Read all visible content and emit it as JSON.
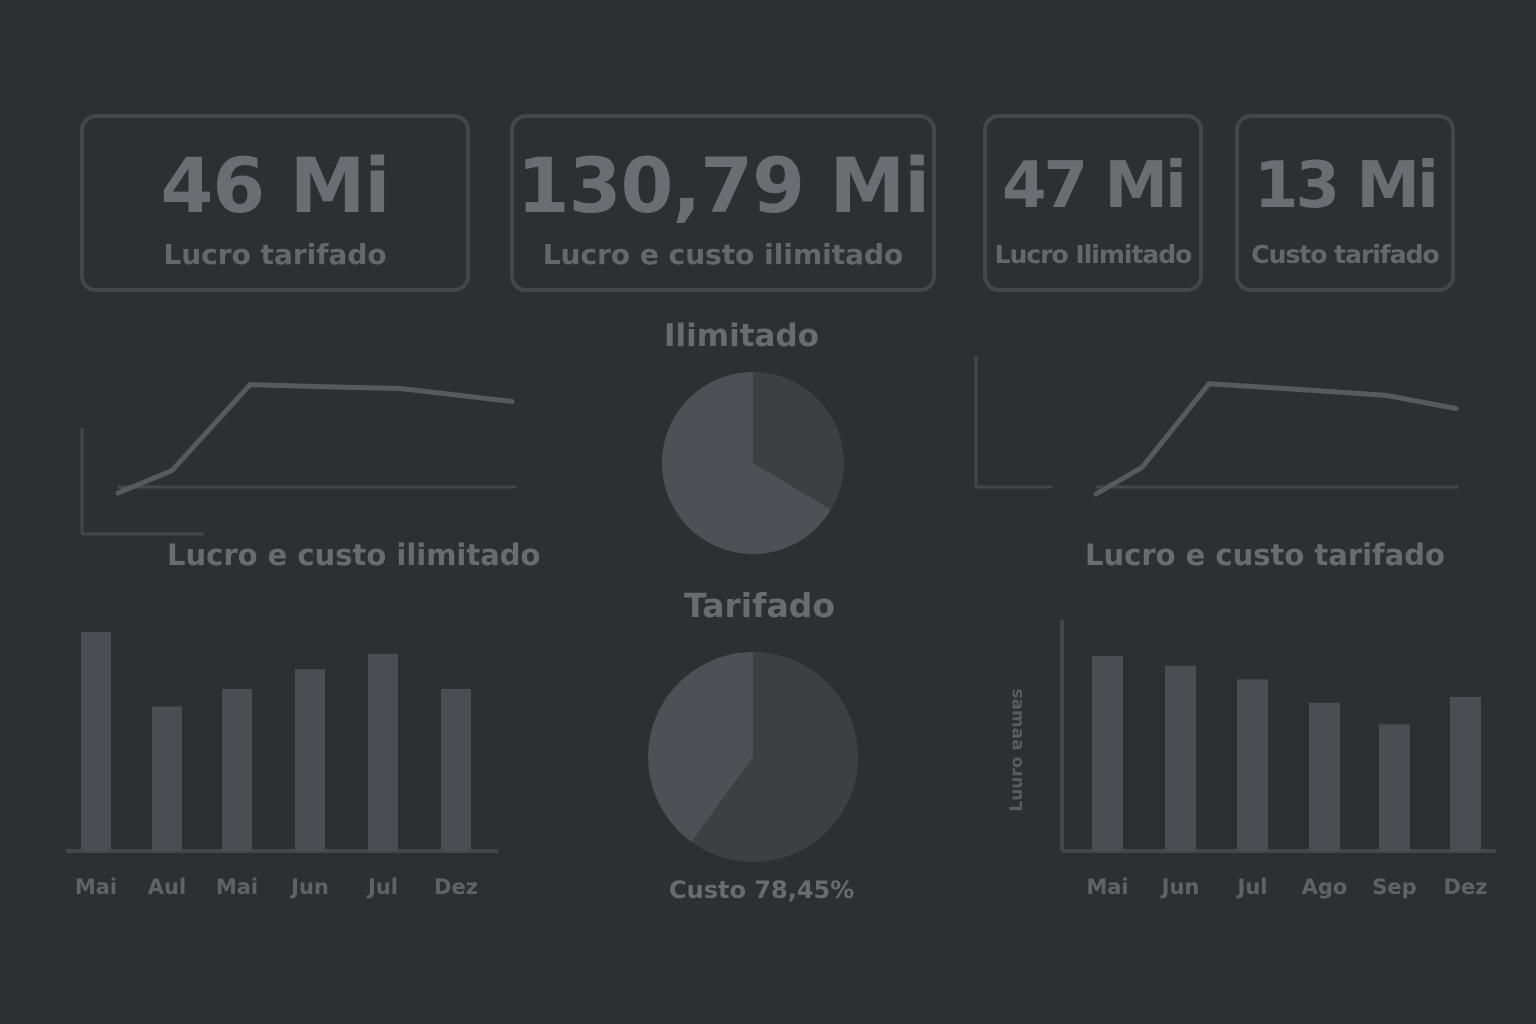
{
  "kpis": [
    {
      "value": "46 Mi",
      "label": "Lucro tarifado"
    },
    {
      "value": "130,79 Mi",
      "label": "Lucro e custo ilimitado"
    },
    {
      "value": "47 Mi",
      "label": "Lucro Ilimitado"
    },
    {
      "value": "13 Mi",
      "label": "Custo tarifado"
    }
  ],
  "titles": {
    "pie_top": "Ilimitado",
    "pie_bottom": "Tarifado",
    "line_left": "Lucro e custo ilimitado",
    "line_right": "Lucro e custo tarifado",
    "pie_bottom_caption": "Custo 78,45%"
  },
  "colors": {
    "background": "#2e2f33",
    "line": "#58595e",
    "bar": "#4c4d52",
    "pie_light": "#4f5055",
    "pie_dark": "#3e3f43",
    "axis": "#45464b",
    "text": "#6a6b70"
  },
  "chart_data": [
    {
      "type": "line",
      "id": "line_left",
      "title": "",
      "series": [
        {
          "values": [
            0,
            12,
            58,
            57,
            56,
            49
          ]
        }
      ],
      "ylim": [
        0,
        60
      ]
    },
    {
      "type": "line",
      "id": "line_right",
      "title": "",
      "series": [
        {
          "values": [
            0,
            14,
            58,
            55,
            52,
            45
          ]
        }
      ],
      "ylim": [
        0,
        60
      ]
    },
    {
      "type": "pie",
      "id": "pie_top",
      "title": "Ilimitado",
      "slices": [
        {
          "value": 0.336,
          "color": "#3e3f43"
        },
        {
          "value": 0.664,
          "color": "#4f5055"
        }
      ]
    },
    {
      "type": "pie",
      "id": "pie_bottom",
      "title": "Tarifado",
      "slices": [
        {
          "value": 0.6,
          "color": "#3e3f43"
        },
        {
          "value": 0.4,
          "color": "#4f5055"
        }
      ],
      "caption": "Custo 78,45%"
    },
    {
      "type": "bar",
      "id": "bar_left",
      "categories": [
        "Mai",
        "Aul",
        "Mai",
        "Jun",
        "Jul",
        "Dez"
      ],
      "values": [
        100,
        66,
        74,
        83,
        90,
        74
      ],
      "ylim": [
        0,
        100
      ]
    },
    {
      "type": "bar",
      "id": "bar_right",
      "categories": [
        "Mai",
        "Jun",
        "Jul",
        "Ago",
        "Sep",
        "Dez"
      ],
      "values": [
        100,
        95,
        88,
        76,
        65,
        79
      ],
      "ylim": [
        0,
        100
      ],
      "ylabel": "Luuro ɐɐɯɐs"
    }
  ]
}
